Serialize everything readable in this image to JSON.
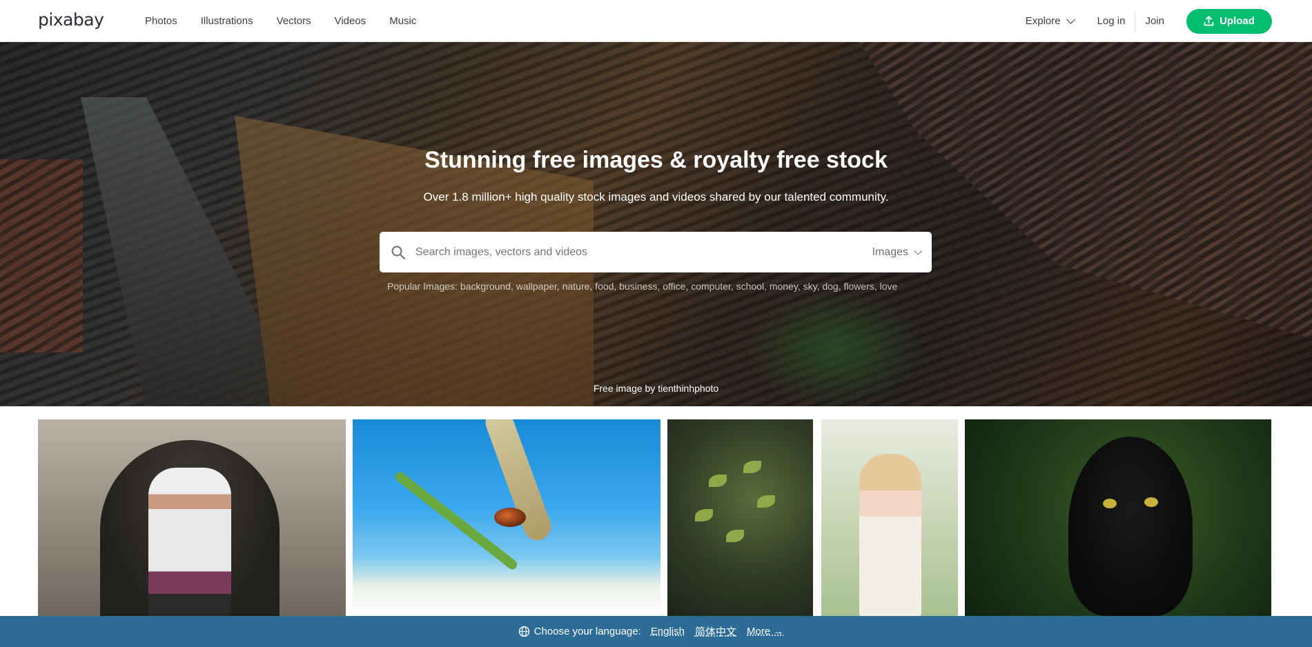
{
  "header": {
    "logo": "pixabay",
    "nav": [
      "Photos",
      "Illustrations",
      "Vectors",
      "Videos",
      "Music"
    ],
    "explore": "Explore",
    "login": "Log in",
    "join": "Join",
    "upload": "Upload",
    "accent_color": "#02be6e"
  },
  "hero": {
    "title": "Stunning free images & royalty free stock",
    "subtitle": "Over 1.8 million+ high quality stock images and videos shared by our talented community.",
    "search_placeholder": "Search images, vectors and videos",
    "search_type": "Images",
    "popular": "Popular Images: background, wallpaper, nature, food, business, office, computer, school, money, sky, dog, flowers, love",
    "credit": "Free image by tienthinhphoto"
  },
  "gallery": {
    "tiles": [
      "man-in-archway",
      "beetle-on-grass",
      "leaves-bokeh",
      "girl-in-field",
      "black-cat"
    ]
  },
  "language_bar": {
    "label": "Choose your language:",
    "english": "English",
    "chinese": "简体中文",
    "more": "More →",
    "bar_color": "#2c6c95"
  }
}
